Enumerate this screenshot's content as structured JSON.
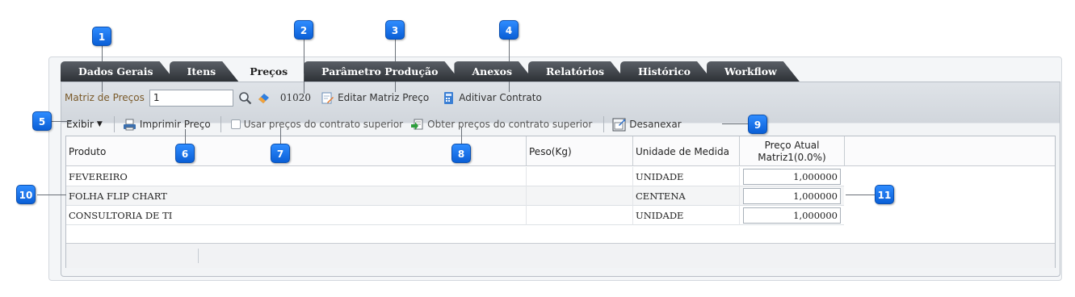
{
  "tabs": [
    {
      "label": "Dados Gerais",
      "active": false
    },
    {
      "label": "Itens",
      "active": false
    },
    {
      "label": "Preços",
      "active": true
    },
    {
      "label": "Parâmetro Produção",
      "active": false
    },
    {
      "label": "Anexos",
      "active": false
    },
    {
      "label": "Relatórios",
      "active": false
    },
    {
      "label": "Histórico",
      "active": false
    },
    {
      "label": "Workflow",
      "active": false
    }
  ],
  "toolbar1": {
    "matriz_label": "Matriz de Preços",
    "matriz_value": "1",
    "code": "01020",
    "editar_label": "Editar Matriz Preço",
    "aditivar_label": "Aditivar Contrato"
  },
  "toolbar2": {
    "exibir_label": "Exibir",
    "imprimir_label": "Imprimir Preço",
    "usar_label": "Usar preços do contrato superior",
    "obter_label": "Obter preços do contrato superior",
    "desanexar_label": "Desanexar"
  },
  "table": {
    "headers": {
      "produto": "Produto",
      "peso": "Peso(Kg)",
      "unidade": "Unidade de Medida",
      "preco_line1": "Preço Atual",
      "preco_line2": "Matriz1(0.0%)"
    },
    "rows": [
      {
        "produto": "FEVEREIRO",
        "peso": "",
        "unidade": "UNIDADE",
        "preco": "1,000000"
      },
      {
        "produto": "FOLHA FLIP CHART",
        "peso": "",
        "unidade": "CENTENA",
        "preco": "1,000000"
      },
      {
        "produto": "CONSULTORIA DE TI",
        "peso": "",
        "unidade": "UNIDADE",
        "preco": "1,000000"
      }
    ]
  },
  "callouts": [
    "1",
    "2",
    "3",
    "4",
    "5",
    "6",
    "7",
    "8",
    "9",
    "10",
    "11"
  ],
  "colors": {
    "callout": "#1a73e8",
    "tab_dark": "#3a3f45",
    "label_brown": "#7a5a2a"
  }
}
